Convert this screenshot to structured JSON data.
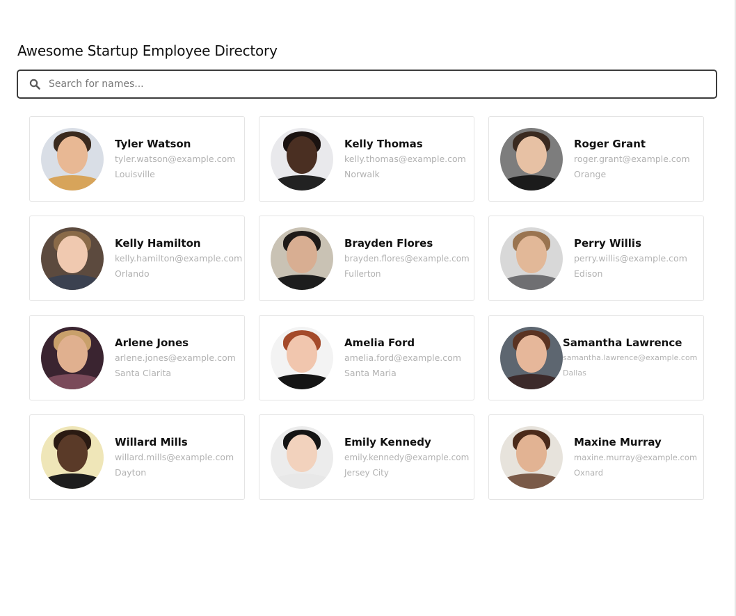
{
  "header": {
    "title": "Awesome Startup Employee Directory"
  },
  "search": {
    "placeholder": "Search for names...",
    "value": "",
    "icon": "search-icon"
  },
  "employees": [
    {
      "name": "Tyler Watson",
      "email": "tyler.watson@example.com",
      "city": "Louisville",
      "avatar_bg": "#d9dee6",
      "skin": "#e8b894",
      "hair": "#3a2a1e",
      "shirt": "#d7a45a"
    },
    {
      "name": "Kelly Thomas",
      "email": "kelly.thomas@example.com",
      "city": "Norwalk",
      "avatar_bg": "#e9e9ec",
      "skin": "#4a2f22",
      "hair": "#1a1210",
      "shirt": "#222222"
    },
    {
      "name": "Roger Grant",
      "email": "roger.grant@example.com",
      "city": "Orange",
      "avatar_bg": "#7d7d7d",
      "skin": "#e7c1a4",
      "hair": "#3a2a20",
      "shirt": "#1b1b1b"
    },
    {
      "name": "Kelly Hamilton",
      "email": "kelly.hamilton@example.com",
      "city": "Orlando",
      "avatar_bg": "#5c4a3e",
      "skin": "#f0c9b0",
      "hair": "#8a6a48",
      "shirt": "#3b4150"
    },
    {
      "name": "Brayden Flores",
      "email": "brayden.flores@example.com",
      "city": "Fullerton",
      "avatar_bg": "#c9c2b4",
      "skin": "#d8ae92",
      "hair": "#1e1a18",
      "shirt": "#1d1d1d"
    },
    {
      "name": "Perry Willis",
      "email": "perry.willis@example.com",
      "city": "Edison",
      "avatar_bg": "#d8d8d8",
      "skin": "#e2b898",
      "hair": "#9a7450",
      "shirt": "#6f6f72"
    },
    {
      "name": "Arlene Jones",
      "email": "arlene.jones@example.com",
      "city": "Santa Clarita",
      "avatar_bg": "#3a2430",
      "skin": "#e0b08f",
      "hair": "#c9a06b",
      "shirt": "#7a4a5a"
    },
    {
      "name": "Amelia Ford",
      "email": "amelia.ford@example.com",
      "city": "Santa Maria",
      "avatar_bg": "#f3f3f3",
      "skin": "#f1c6ae",
      "hair": "#a44a2a",
      "shirt": "#151515"
    },
    {
      "name": "Samantha Lawrence",
      "email": "samantha.lawrence@example.com",
      "city": "Dallas",
      "avatar_bg": "#5d6670",
      "skin": "#e6b79a",
      "hair": "#5a3322",
      "shirt": "#3c2a2a"
    },
    {
      "name": "Willard Mills",
      "email": "willard.mills@example.com",
      "city": "Dayton",
      "avatar_bg": "#efe6b8",
      "skin": "#5a3a28",
      "hair": "#2a1a12",
      "shirt": "#1d1d1d"
    },
    {
      "name": "Emily Kennedy",
      "email": "emily.kennedy@example.com",
      "city": "Jersey City",
      "avatar_bg": "#ececec",
      "skin": "#f2d2bd",
      "hair": "#141414",
      "shirt": "#e8e8e8"
    },
    {
      "name": "Maxine Murray",
      "email": "maxine.murray@example.com",
      "city": "Oxnard",
      "avatar_bg": "#e7e3dc",
      "skin": "#e2b393",
      "hair": "#4a2a1a",
      "shirt": "#7a5a48"
    }
  ]
}
